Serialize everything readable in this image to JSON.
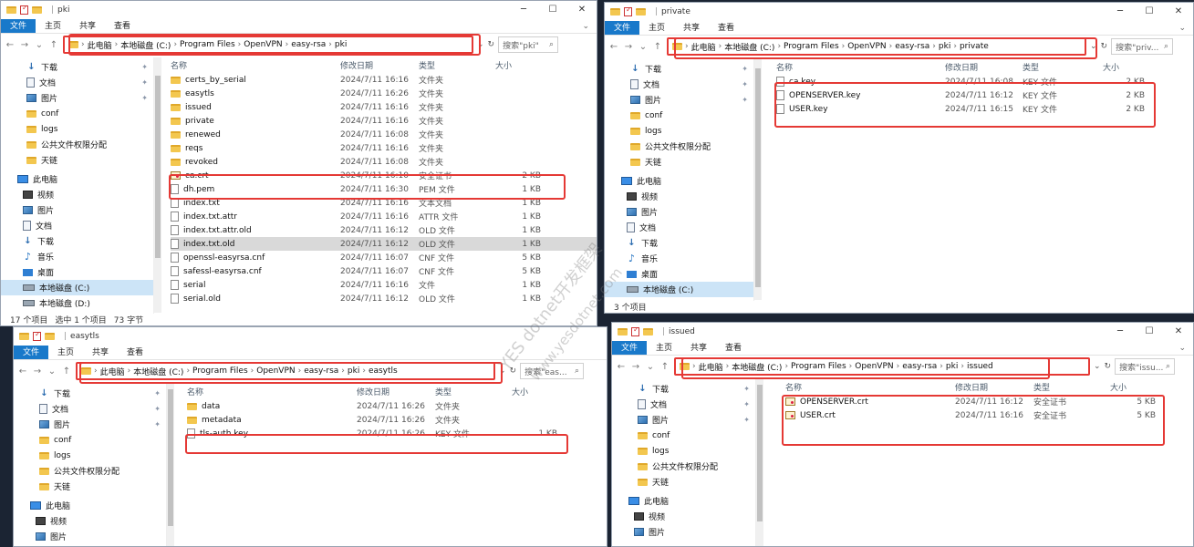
{
  "windows": {
    "pki": {
      "title": "pki",
      "ribbon": {
        "file": "文件",
        "home": "主页",
        "share": "共享",
        "view": "查看"
      },
      "breadcrumb": [
        "此电脑",
        "本地磁盘 (C:)",
        "Program Files",
        "OpenVPN",
        "easy-rsa",
        "pki"
      ],
      "search_placeholder": "搜索\"pki\"",
      "columns": {
        "name": "名称",
        "date": "修改日期",
        "type": "类型",
        "size": "大小"
      },
      "nav": [
        {
          "label": "下载",
          "icon": "download-icon"
        },
        {
          "label": "文档",
          "icon": "document-icon"
        },
        {
          "label": "图片",
          "icon": "picture-icon"
        },
        {
          "label": "conf",
          "icon": "folder-icon"
        },
        {
          "label": "logs",
          "icon": "folder-icon"
        },
        {
          "label": "公共文件权限分配",
          "icon": "folder-icon"
        },
        {
          "label": "天链",
          "icon": "folder-icon"
        },
        {
          "label": "此电脑",
          "icon": "computer-icon"
        },
        {
          "label": "视频",
          "icon": "video-icon"
        },
        {
          "label": "图片",
          "icon": "picture-icon"
        },
        {
          "label": "文档",
          "icon": "document-icon"
        },
        {
          "label": "下载",
          "icon": "download-icon"
        },
        {
          "label": "音乐",
          "icon": "music-icon"
        },
        {
          "label": "桌面",
          "icon": "desktop-icon"
        },
        {
          "label": "本地磁盘 (C:)",
          "icon": "drive-icon"
        },
        {
          "label": "本地磁盘 (D:)",
          "icon": "drive-icon"
        }
      ],
      "files": [
        {
          "name": "certs_by_serial",
          "date": "2024/7/11 16:16",
          "type": "文件夹",
          "size": "",
          "icon": "folder"
        },
        {
          "name": "easytls",
          "date": "2024/7/11 16:26",
          "type": "文件夹",
          "size": "",
          "icon": "folder"
        },
        {
          "name": "issued",
          "date": "2024/7/11 16:16",
          "type": "文件夹",
          "size": "",
          "icon": "folder"
        },
        {
          "name": "private",
          "date": "2024/7/11 16:16",
          "type": "文件夹",
          "size": "",
          "icon": "folder"
        },
        {
          "name": "renewed",
          "date": "2024/7/11 16:08",
          "type": "文件夹",
          "size": "",
          "icon": "folder"
        },
        {
          "name": "reqs",
          "date": "2024/7/11 16:16",
          "type": "文件夹",
          "size": "",
          "icon": "folder"
        },
        {
          "name": "revoked",
          "date": "2024/7/11 16:08",
          "type": "文件夹",
          "size": "",
          "icon": "folder"
        },
        {
          "name": "ca.crt",
          "date": "2024/7/11 16:10",
          "type": "安全证书",
          "size": "2 KB",
          "icon": "cert"
        },
        {
          "name": "dh.pem",
          "date": "2024/7/11 16:30",
          "type": "PEM 文件",
          "size": "1 KB",
          "icon": "file"
        },
        {
          "name": "index.txt",
          "date": "2024/7/11 16:16",
          "type": "文本文档",
          "size": "1 KB",
          "icon": "file"
        },
        {
          "name": "index.txt.attr",
          "date": "2024/7/11 16:16",
          "type": "ATTR 文件",
          "size": "1 KB",
          "icon": "file"
        },
        {
          "name": "index.txt.attr.old",
          "date": "2024/7/11 16:12",
          "type": "OLD 文件",
          "size": "1 KB",
          "icon": "file"
        },
        {
          "name": "index.txt.old",
          "date": "2024/7/11 16:12",
          "type": "OLD 文件",
          "size": "1 KB",
          "icon": "file"
        },
        {
          "name": "openssl-easyrsa.cnf",
          "date": "2024/7/11 16:07",
          "type": "CNF 文件",
          "size": "5 KB",
          "icon": "file"
        },
        {
          "name": "safessl-easyrsa.cnf",
          "date": "2024/7/11 16:07",
          "type": "CNF 文件",
          "size": "5 KB",
          "icon": "file"
        },
        {
          "name": "serial",
          "date": "2024/7/11 16:16",
          "type": "文件",
          "size": "1 KB",
          "icon": "file"
        },
        {
          "name": "serial.old",
          "date": "2024/7/11 16:12",
          "type": "OLD 文件",
          "size": "1 KB",
          "icon": "file"
        }
      ],
      "status": {
        "count": "17 个项目",
        "selected": "选中 1 个项目",
        "size": "73 字节"
      }
    },
    "private": {
      "title": "private",
      "ribbon": {
        "file": "文件",
        "home": "主页",
        "share": "共享",
        "view": "查看"
      },
      "breadcrumb": [
        "此电脑",
        "本地磁盘 (C:)",
        "Program Files",
        "OpenVPN",
        "easy-rsa",
        "pki",
        "private"
      ],
      "search_placeholder": "搜索\"priv...",
      "columns": {
        "name": "名称",
        "date": "修改日期",
        "type": "类型",
        "size": "大小"
      },
      "nav": [
        {
          "label": "下载",
          "icon": "download-icon"
        },
        {
          "label": "文档",
          "icon": "document-icon"
        },
        {
          "label": "图片",
          "icon": "picture-icon"
        },
        {
          "label": "conf",
          "icon": "folder-icon"
        },
        {
          "label": "logs",
          "icon": "folder-icon"
        },
        {
          "label": "公共文件权限分配",
          "icon": "folder-icon"
        },
        {
          "label": "天链",
          "icon": "folder-icon"
        },
        {
          "label": "此电脑",
          "icon": "computer-icon"
        },
        {
          "label": "视频",
          "icon": "video-icon"
        },
        {
          "label": "图片",
          "icon": "picture-icon"
        },
        {
          "label": "文档",
          "icon": "document-icon"
        },
        {
          "label": "下载",
          "icon": "download-icon"
        },
        {
          "label": "音乐",
          "icon": "music-icon"
        },
        {
          "label": "桌面",
          "icon": "desktop-icon"
        },
        {
          "label": "本地磁盘 (C:)",
          "icon": "drive-icon"
        }
      ],
      "files": [
        {
          "name": "ca.key",
          "date": "2024/7/11 16:08",
          "type": "KEY 文件",
          "size": "2 KB",
          "icon": "file"
        },
        {
          "name": "OPENSERVER.key",
          "date": "2024/7/11 16:12",
          "type": "KEY 文件",
          "size": "2 KB",
          "icon": "file"
        },
        {
          "name": "USER.key",
          "date": "2024/7/11 16:15",
          "type": "KEY 文件",
          "size": "2 KB",
          "icon": "file"
        }
      ],
      "status": {
        "count": "3 个项目"
      }
    },
    "easytls": {
      "title": "easytls",
      "ribbon": {
        "file": "文件",
        "home": "主页",
        "share": "共享",
        "view": "查看"
      },
      "breadcrumb": [
        "此电脑",
        "本地磁盘 (C:)",
        "Program Files",
        "OpenVPN",
        "easy-rsa",
        "pki",
        "easytls"
      ],
      "search_placeholder": "搜索\"eas...",
      "columns": {
        "name": "名称",
        "date": "修改日期",
        "type": "类型",
        "size": "大小"
      },
      "nav": [
        {
          "label": "下载",
          "icon": "download-icon"
        },
        {
          "label": "文档",
          "icon": "document-icon"
        },
        {
          "label": "图片",
          "icon": "picture-icon"
        },
        {
          "label": "conf",
          "icon": "folder-icon"
        },
        {
          "label": "logs",
          "icon": "folder-icon"
        },
        {
          "label": "公共文件权限分配",
          "icon": "folder-icon"
        },
        {
          "label": "天链",
          "icon": "folder-icon"
        },
        {
          "label": "此电脑",
          "icon": "computer-icon"
        },
        {
          "label": "视频",
          "icon": "video-icon"
        },
        {
          "label": "图片",
          "icon": "picture-icon"
        }
      ],
      "files": [
        {
          "name": "data",
          "date": "2024/7/11 16:26",
          "type": "文件夹",
          "size": "",
          "icon": "folder"
        },
        {
          "name": "metadata",
          "date": "2024/7/11 16:26",
          "type": "文件夹",
          "size": "",
          "icon": "folder"
        },
        {
          "name": "tls-auth.key",
          "date": "2024/7/11 16:26",
          "type": "KEY 文件",
          "size": "1 KB",
          "icon": "file"
        }
      ]
    },
    "issued": {
      "title": "issued",
      "ribbon": {
        "file": "文件",
        "home": "主页",
        "share": "共享",
        "view": "查看"
      },
      "breadcrumb": [
        "此电脑",
        "本地磁盘 (C:)",
        "Program Files",
        "OpenVPN",
        "easy-rsa",
        "pki",
        "issued"
      ],
      "search_placeholder": "搜索\"issu...",
      "columns": {
        "name": "名称",
        "date": "修改日期",
        "type": "类型",
        "size": "大小"
      },
      "nav": [
        {
          "label": "下载",
          "icon": "download-icon"
        },
        {
          "label": "文档",
          "icon": "document-icon"
        },
        {
          "label": "图片",
          "icon": "picture-icon"
        },
        {
          "label": "conf",
          "icon": "folder-icon"
        },
        {
          "label": "logs",
          "icon": "folder-icon"
        },
        {
          "label": "公共文件权限分配",
          "icon": "folder-icon"
        },
        {
          "label": "天链",
          "icon": "folder-icon"
        },
        {
          "label": "此电脑",
          "icon": "computer-icon"
        },
        {
          "label": "视频",
          "icon": "video-icon"
        },
        {
          "label": "图片",
          "icon": "picture-icon"
        }
      ],
      "files": [
        {
          "name": "OPENSERVER.crt",
          "date": "2024/7/11 16:12",
          "type": "安全证书",
          "size": "5 KB",
          "icon": "cert"
        },
        {
          "name": "USER.crt",
          "date": "2024/7/11 16:16",
          "type": "安全证书",
          "size": "5 KB",
          "icon": "cert"
        }
      ]
    }
  },
  "watermark": {
    "line1": "YES dotnet开发框架",
    "line2": "www.yesdotnet.com"
  },
  "colors": {
    "accent": "#1979ca",
    "highlight": "#e53935"
  }
}
